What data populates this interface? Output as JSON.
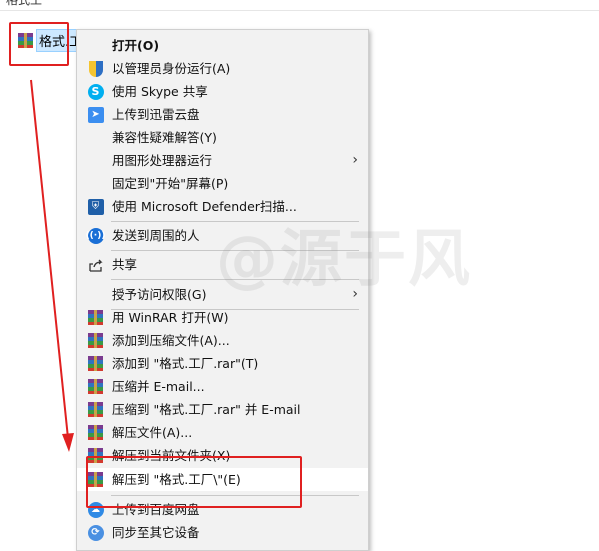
{
  "desktop": {
    "top_text": "格式工",
    "file_label": "格式.工"
  },
  "menu": {
    "items": [
      {
        "label": "打开(O)",
        "icon": "none",
        "bold": true
      },
      {
        "label": "以管理员身份运行(A)",
        "icon": "uac-shield-icon"
      },
      {
        "label": "使用 Skype 共享",
        "icon": "skype-icon"
      },
      {
        "label": "上传到迅雷云盘",
        "icon": "xunlei-cloud-icon"
      },
      {
        "label": "兼容性疑难解答(Y)",
        "icon": "none"
      },
      {
        "label": "用图形处理器运行",
        "icon": "none",
        "submenu": true
      },
      {
        "label": "固定到\"开始\"屏幕(P)",
        "icon": "none"
      },
      {
        "label": "使用 Microsoft Defender扫描...",
        "icon": "defender-icon"
      },
      {
        "label": "发送到周围的人",
        "icon": "nearby-share-icon"
      },
      {
        "label": "共享",
        "icon": "share-icon"
      },
      {
        "label": "授予访问权限(G)",
        "icon": "none",
        "submenu": true
      },
      {
        "label": "用 WinRAR 打开(W)",
        "icon": "winrar-icon"
      },
      {
        "label": "添加到压缩文件(A)...",
        "icon": "winrar-icon"
      },
      {
        "label": "添加到 \"格式.工厂.rar\"(T)",
        "icon": "winrar-icon"
      },
      {
        "label": "压缩并 E-mail...",
        "icon": "winrar-icon"
      },
      {
        "label": "压缩到 \"格式.工厂.rar\" 并 E-mail",
        "icon": "winrar-icon"
      },
      {
        "label": "解压文件(A)...",
        "icon": "winrar-icon"
      },
      {
        "label": "解压到当前文件夹(X)",
        "icon": "winrar-icon"
      },
      {
        "label": "解压到 \"格式.工厂\\\"(E)",
        "icon": "winrar-icon"
      },
      {
        "label": "上传到百度网盘",
        "icon": "baidu-cloud-icon"
      },
      {
        "label": "同步至其它设备",
        "icon": "sync-icon"
      }
    ],
    "submenu_arrow": "›"
  },
  "watermark": "@源于风",
  "colors": {
    "highlight_red": "#e02020",
    "menu_bg": "#f2f2f2",
    "hover_bg": "#ffffff"
  }
}
